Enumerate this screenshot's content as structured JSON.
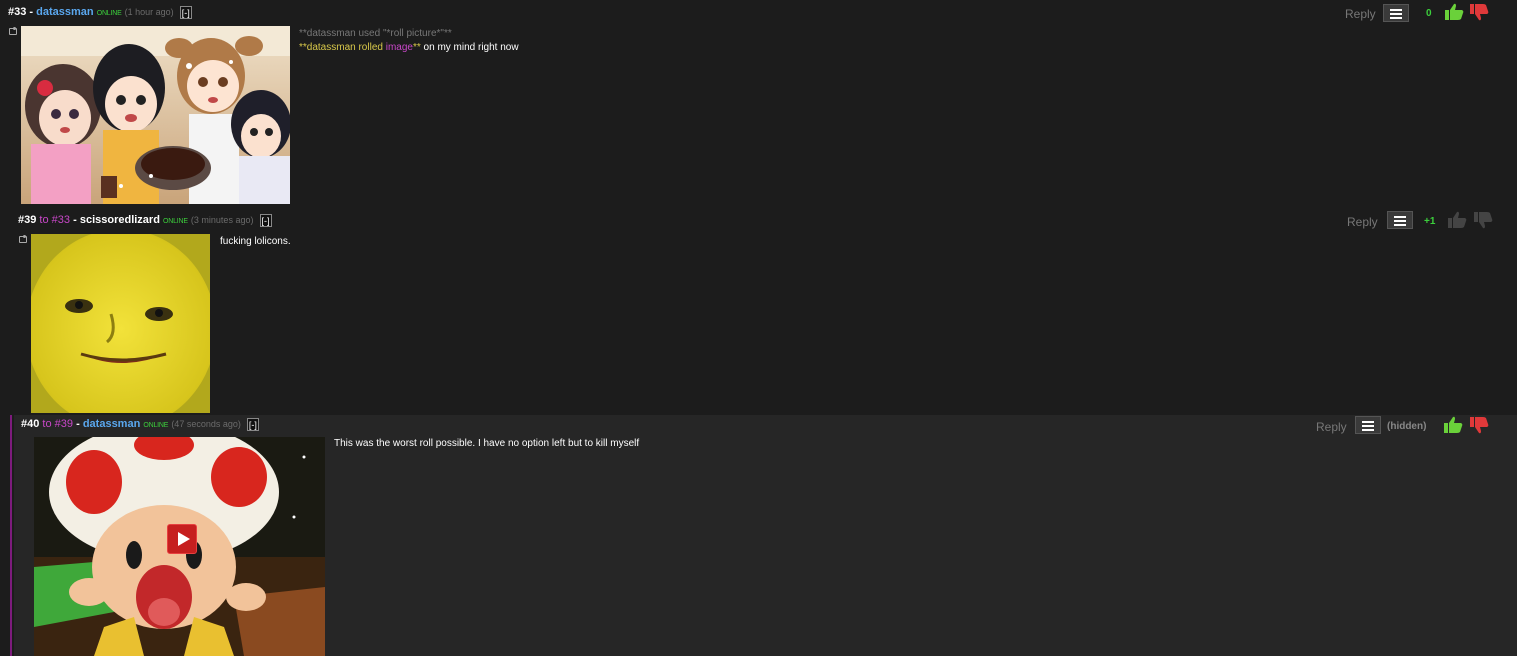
{
  "comments": [
    {
      "number": "#33",
      "reply_to": "",
      "username": "datassman",
      "status": "ONLINE",
      "time": "(1 hour ago)",
      "collapse": "[-]",
      "line1": "**datassman used \"*roll picture*\"**",
      "line2_prefix": "**datassman rolled ",
      "line2_link": "image",
      "line2_suffix": "**",
      "line2_rest": " on my mind right now",
      "reply_label": "Reply",
      "score": "0"
    },
    {
      "number": "#39",
      "reply_to_prefix": "to",
      "reply_to": "#33",
      "username": "scissoredlizard",
      "status": "ONLINE",
      "time": "(3 minutes ago)",
      "collapse": "[-]",
      "text": "fucking lolicons.",
      "reply_label": "Reply",
      "score": "+1"
    },
    {
      "number": "#40",
      "reply_to_prefix": "to",
      "reply_to": "#39",
      "username": "datassman",
      "status": "ONLINE",
      "time": "(47 seconds ago)",
      "collapse": "[-]",
      "text": "This was the worst roll possible. I have no option left but to kill myself",
      "reply_label": "Reply",
      "score": "(hidden)"
    }
  ],
  "colors": {
    "background": "#1c1c1c",
    "username_link": "#5aa7ee",
    "reply_ref": "#c847c8",
    "online": "#3ccf3c",
    "thumb_up": "#6ad13a",
    "thumb_down": "#e0393a"
  }
}
